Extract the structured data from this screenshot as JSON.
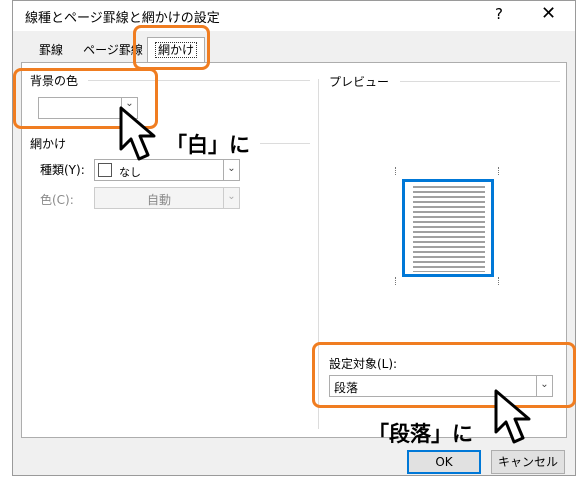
{
  "window": {
    "title": "線種とページ罫線と網かけの設定",
    "help_label": "?",
    "close_label": "✕"
  },
  "tabs": [
    {
      "label": "罫線"
    },
    {
      "label": "ページ罫線"
    },
    {
      "label": "網かけ"
    }
  ],
  "fill": {
    "group_label": "背景の色",
    "value": ""
  },
  "shading": {
    "group_label": "網かけ",
    "style_label": "種類(Y):",
    "style_value": "なし",
    "color_label": "色(C):",
    "color_value": "自動"
  },
  "preview": {
    "group_label": "プレビュー"
  },
  "apply_to": {
    "label": "設定対象(L):",
    "value": "段落"
  },
  "buttons": {
    "ok": "OK",
    "cancel": "キャンセル"
  },
  "annotations": {
    "callout_fill": "「白」に",
    "callout_apply": "「段落」に"
  },
  "colors": {
    "highlight": "#f07d21",
    "preview_border": "#0078d7"
  }
}
